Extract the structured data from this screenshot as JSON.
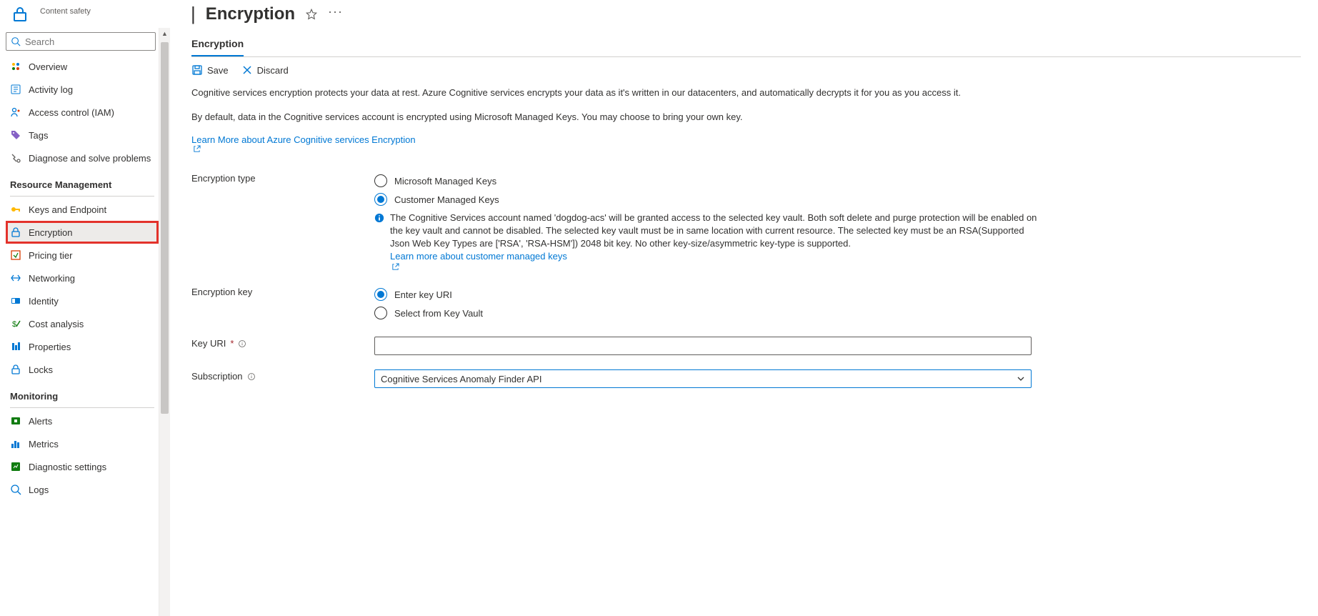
{
  "header": {
    "subtype": "Content safety",
    "title": "Encryption",
    "pipe": "|"
  },
  "search": {
    "placeholder": "Search"
  },
  "sidebar": {
    "items_top": [
      {
        "label": "Overview"
      },
      {
        "label": "Activity log"
      },
      {
        "label": "Access control (IAM)"
      },
      {
        "label": "Tags"
      },
      {
        "label": "Diagnose and solve problems"
      }
    ],
    "section_rm": "Resource Management",
    "items_rm": [
      {
        "label": "Keys and Endpoint"
      },
      {
        "label": "Encryption"
      },
      {
        "label": "Pricing tier"
      },
      {
        "label": "Networking"
      },
      {
        "label": "Identity"
      },
      {
        "label": "Cost analysis"
      },
      {
        "label": "Properties"
      },
      {
        "label": "Locks"
      }
    ],
    "section_mon": "Monitoring",
    "items_mon": [
      {
        "label": "Alerts"
      },
      {
        "label": "Metrics"
      },
      {
        "label": "Diagnostic settings"
      },
      {
        "label": "Logs"
      }
    ]
  },
  "main": {
    "tab": "Encryption",
    "save": "Save",
    "discard": "Discard",
    "para1": "Cognitive services encryption protects your data at rest. Azure Cognitive services encrypts your data as it's written in our datacenters, and automatically decrypts it for you as you access it.",
    "para2": "By default, data in the Cognitive services account is encrypted using Microsoft Managed Keys. You may choose to bring your own key.",
    "learn": "Learn More about Azure Cognitive services Encryption",
    "enc_type_label": "Encryption type",
    "enc_type_opts": [
      "Microsoft Managed Keys",
      "Customer Managed Keys"
    ],
    "info_text": "The Cognitive Services account named 'dogdog-acs' will be granted access to the selected key vault. Both soft delete and purge protection will be enabled on the key vault and cannot be disabled. The selected key vault must be in same location with current resource. The selected key must be an RSA(Supported Json Web Key Types are ['RSA', 'RSA-HSM']) 2048 bit key. No other key-size/asymmetric key-type is supported.",
    "info_link": "Learn more about customer managed keys",
    "enc_key_label": "Encryption key",
    "enc_key_opts": [
      "Enter key URI",
      "Select from Key Vault"
    ],
    "key_uri_label": "Key URI",
    "key_uri_value": "",
    "subscription_label": "Subscription",
    "subscription_value": "Cognitive Services Anomaly Finder API"
  }
}
